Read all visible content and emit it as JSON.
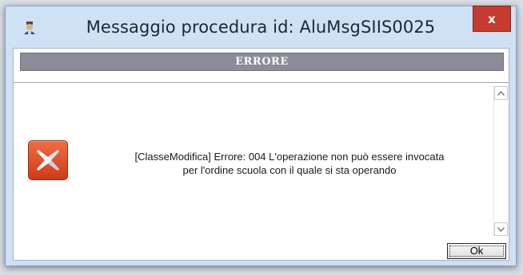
{
  "window": {
    "title": "Messaggio procedura id: AluMsgSIIS0025",
    "close_label": "x"
  },
  "banner": {
    "label": "ERRORE"
  },
  "message": {
    "line1": "[ClasseModifica] Errore: 004 L'operazione non può essere invocata",
    "line2": "per l'ordine scuola con il quale si sta operando"
  },
  "buttons": {
    "ok_label": "Ok"
  },
  "colors": {
    "close_button": "#c63b2f",
    "banner": "#8b8c98",
    "error_icon": "#e35a2f"
  },
  "icons": {
    "app": "app-icon",
    "error": "error-x-icon",
    "scroll_up": "chevron-up-icon",
    "scroll_down": "chevron-down-icon"
  }
}
